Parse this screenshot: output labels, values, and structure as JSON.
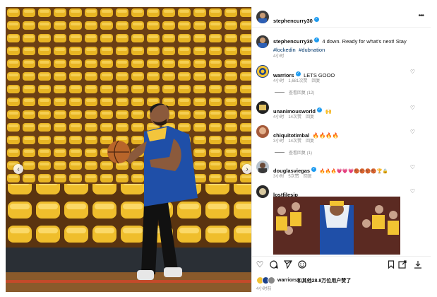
{
  "header": {
    "username": "stephencurry30",
    "more_icon": "more-dots-icon"
  },
  "caption": {
    "username": "stephencurry30",
    "text": "4 down. Ready for what's next! Stay",
    "hashtag1": "#lockedin",
    "hashtag2": "#dubnation",
    "time": "4小时"
  },
  "comments": [
    {
      "username": "warriors",
      "text": "LETS GOOO",
      "time": "4小时",
      "likes": "1,681次赞",
      "reply": "回复",
      "view_replies": "查看回复 (12)"
    },
    {
      "username": "unanimousworld",
      "text": "🙌",
      "time": "4小时",
      "likes": "14次赞",
      "reply": "回复"
    },
    {
      "username": "chiquitotimbal",
      "text": "🔥🔥🔥🔥",
      "time": "3小时",
      "likes": "14次赞",
      "reply": "回复",
      "view_replies": "查看回复 (1)"
    },
    {
      "username": "douglasviegas",
      "text": "🔥🔥🔥💗💗💗🏀🏀🏀🏀🏆🔒",
      "time": "3小时",
      "likes": "5次赞",
      "reply": "回复"
    },
    {
      "username": "lostfilesjp",
      "text": ""
    }
  ],
  "actions": {
    "like_icon": "heart-icon",
    "comment_icon": "comment-icon",
    "share_icon": "send-icon",
    "emoji_icon": "emoji-icon",
    "save_icon": "bookmark-icon",
    "external_icon": "open-external-icon",
    "download_icon": "download-icon"
  },
  "likes_summary": {
    "name": "warriors",
    "rest": "和其他28.8万位用户赞了"
  },
  "post_time": "4小时前",
  "colors": {
    "verified": "#1d9bf0",
    "link": "#00376b",
    "seat_yellow": "#e8b523",
    "jersey_blue": "#1f4fa8"
  }
}
